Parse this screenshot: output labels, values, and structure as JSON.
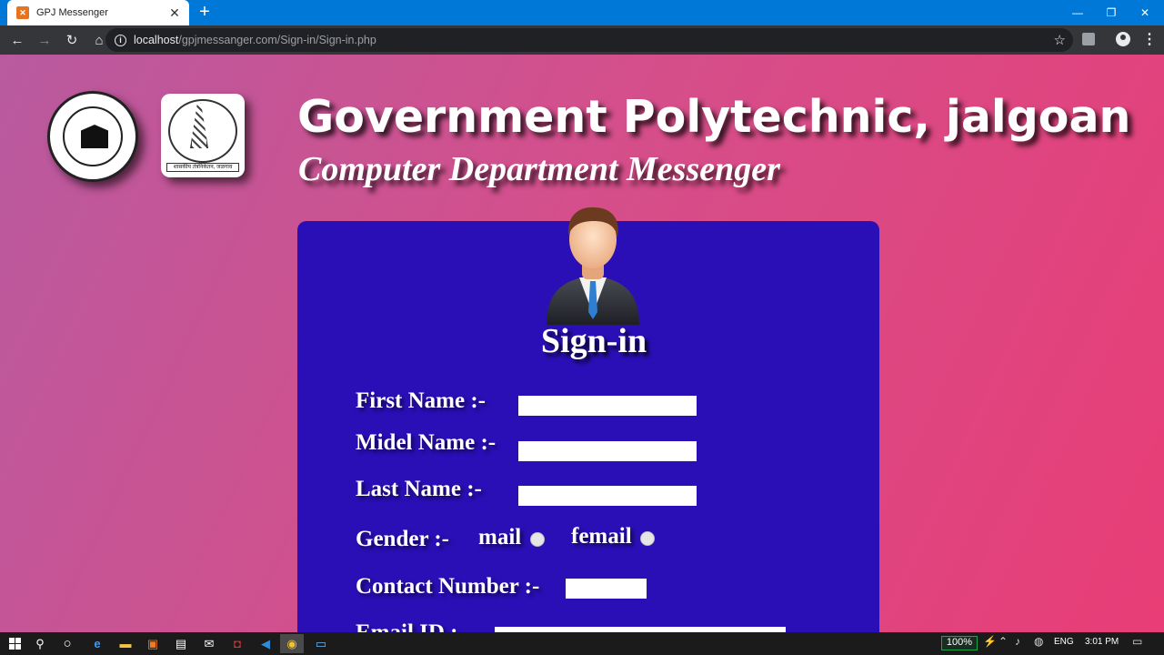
{
  "browser": {
    "tab_title": "GPJ Messenger",
    "tab_close": "✕",
    "new_tab": "+",
    "url_host": "localhost",
    "url_path": "/gpjmessanger.com/Sign-in/Sign-in.php",
    "window_controls": {
      "minimize": "—",
      "maximize": "❐",
      "close": "✕"
    },
    "nav": {
      "back": "←",
      "forward": "→",
      "reload": "↻",
      "home": "⌂"
    },
    "star": "☆",
    "menu": "⋮"
  },
  "header": {
    "title": "Government Polytechnic, jalgoan",
    "subtitle": "Computer Department Messenger",
    "logo2_caption": "शासकीय तंत्रनिकेतन, जळगाव"
  },
  "form": {
    "heading": "Sign-in",
    "first_name_label": "First Name :-",
    "middle_name_label": "Midel Name :-",
    "last_name_label": "Last Name :-",
    "gender_label": "Gender :-",
    "gender_options": [
      "mail",
      "femail"
    ],
    "contact_label": "Contact Number :-",
    "email_label": "Email ID :-",
    "first_name_value": "",
    "middle_name_value": "",
    "last_name_value": "",
    "contact_value": "",
    "email_value": ""
  },
  "taskbar": {
    "battery": "100%",
    "language": "ENG",
    "time": "3:01 PM"
  },
  "colors": {
    "card": "#2a0fb7",
    "chrome_tab": "#0078d7",
    "chrome_toolbar": "#35363a",
    "page_gradient_start": "#b95a9f",
    "page_gradient_end": "#e83d76"
  }
}
